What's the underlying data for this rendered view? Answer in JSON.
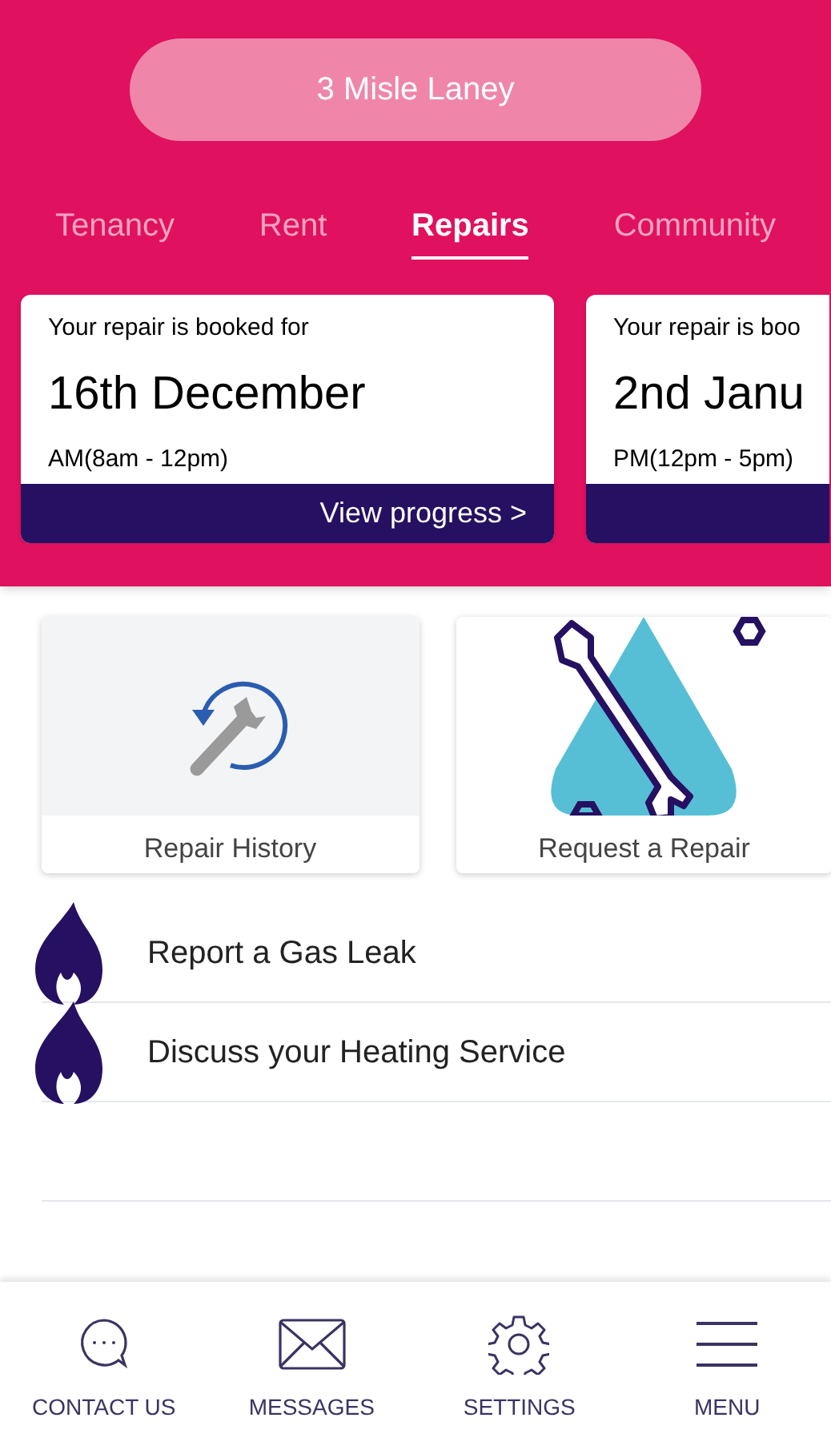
{
  "address": "3 Misle Laney",
  "tabs": [
    {
      "label": "Tenancy",
      "selected": false
    },
    {
      "label": "Rent",
      "selected": false
    },
    {
      "label": "Repairs",
      "selected": true
    },
    {
      "label": "Community",
      "selected": false
    }
  ],
  "bookings": [
    {
      "heading": "Your repair is booked for",
      "date": "16th December",
      "slot": "AM(8am - 12pm)",
      "action": "View progress >"
    },
    {
      "heading": "Your repair is boo",
      "date": "2nd Janu",
      "slot": "PM(12pm - 5pm)"
    }
  ],
  "tiles": [
    {
      "kind": "history",
      "label": "Repair History"
    },
    {
      "kind": "request",
      "label": "Request a Repair"
    }
  ],
  "links": [
    {
      "label": "Report a Gas Leak"
    },
    {
      "label": "Discuss your Heating Service"
    }
  ],
  "nav": [
    {
      "kind": "chat",
      "label": "CONTACT US"
    },
    {
      "kind": "mail",
      "label": "MESSAGES"
    },
    {
      "kind": "gear",
      "label": "SETTINGS"
    },
    {
      "kind": "menu",
      "label": "MENU"
    }
  ]
}
